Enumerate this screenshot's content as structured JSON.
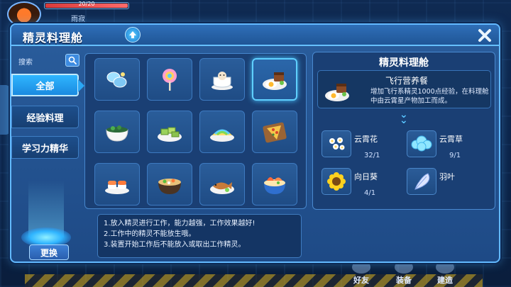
{
  "background": {
    "hp_text": "20/20",
    "player_name": "雨寂",
    "bottom_nav": [
      {
        "label": "好友"
      },
      {
        "label": "装备"
      },
      {
        "label": "建造"
      }
    ]
  },
  "panel": {
    "title": "精灵料理舱",
    "upgrade_icon": "up-arrow-icon",
    "close_icon": "close-icon"
  },
  "search": {
    "label": "搜索",
    "icon": "search-icon"
  },
  "tabs": [
    {
      "label": "全部",
      "active": true
    },
    {
      "label": "经验料理",
      "active": false
    },
    {
      "label": "学习力精华",
      "active": false
    }
  ],
  "swap_button": "更换",
  "recipes": [
    {
      "name": "blue-candy-icon"
    },
    {
      "name": "lollipop-icon"
    },
    {
      "name": "teacup-icon"
    },
    {
      "name": "fried-egg-meal-icon",
      "selected": true
    },
    {
      "name": "seaweed-bowl-icon"
    },
    {
      "name": "green-cake-plate-icon"
    },
    {
      "name": "rainbow-sushi-icon"
    },
    {
      "name": "pizza-board-icon"
    },
    {
      "name": "salmon-sushi-icon"
    },
    {
      "name": "veggie-soup-icon"
    },
    {
      "name": "grilled-fish-icon"
    },
    {
      "name": "seafood-bowl-icon"
    }
  ],
  "tips": [
    "1.放入精灵进行工作，能力越强，工作效果越好!",
    "2.工作中的精灵不能放生哦。",
    "3.装置开始工作后不能放入或取出工作精灵。"
  ],
  "detail": {
    "title": "精灵料理舱",
    "dish_name": "飞行营养餐",
    "dish_desc": "增加飞行系精灵1000点经验，在料理舱中由云霄星产物加工而成。",
    "materials": [
      {
        "name": "云霄花",
        "count": "32/1",
        "icon": "white-flowers-icon"
      },
      {
        "name": "云霄草",
        "count": "9/1",
        "icon": "cloud-grass-icon"
      },
      {
        "name": "向日葵",
        "count": "4/1",
        "icon": "sunflower-icon"
      },
      {
        "name": "羽叶",
        "count": "",
        "icon": "feather-leaf-icon"
      }
    ]
  },
  "colors": {
    "panel_border": "#62b9ff",
    "active_tab": "#2fb6ff",
    "selected_slot": "#5fd0ff"
  }
}
